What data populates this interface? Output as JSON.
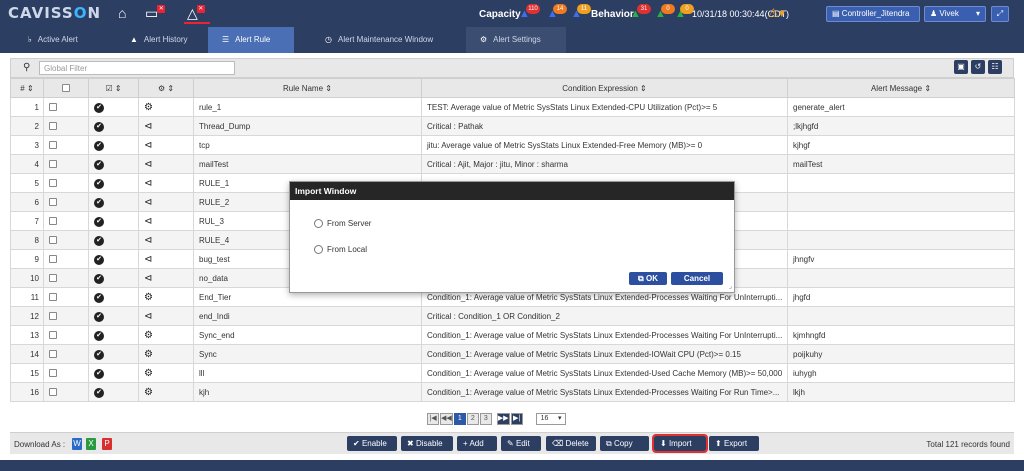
{
  "app": {
    "logo_left": "CAVISS",
    "logo_o": "O",
    "logo_right": "N"
  },
  "topbar": {
    "capacity_label": "Capacity",
    "capacity_badges": [
      "110",
      "14",
      "11"
    ],
    "behavior_label": "Behavior",
    "behavior_badges": [
      "31",
      "0",
      "0"
    ],
    "datetime": "10/31/18 00:30:44(CDT)",
    "controller_label": "Controller_Jitendra",
    "user_label": "Vivek"
  },
  "tabs": [
    {
      "label": "Active Alert"
    },
    {
      "label": "Alert History"
    },
    {
      "label": "Alert Rule"
    },
    {
      "label": "Alert Maintenance Window"
    },
    {
      "label": "Alert Settings"
    }
  ],
  "filter": {
    "placeholder": "Global Filter"
  },
  "table": {
    "headers": {
      "num": "#",
      "rule_name": "Rule Name",
      "condition": "Condition Expression",
      "message": "Alert Message"
    },
    "rows": [
      {
        "n": "1",
        "icon": "gear",
        "name": "rule_1",
        "cond": "TEST: Average value of Metric SysStats Linux Extended-CPU Utilization (Pct)>= 5",
        "msg": "generate_alert"
      },
      {
        "n": "2",
        "icon": "share",
        "name": "Thread_Dump",
        "cond": "Critical : Pathak",
        "msg": ";lkjhgfd"
      },
      {
        "n": "3",
        "icon": "share",
        "name": "tcp",
        "cond": "jitu: Average value of Metric SysStats Linux Extended-Free Memory (MB)>= 0",
        "msg": "kjhgf"
      },
      {
        "n": "4",
        "icon": "share",
        "name": "mailTest",
        "cond": "Critical : Ajit, Major : jitu, Minor : sharma",
        "msg": "mailTest"
      },
      {
        "n": "5",
        "icon": "share",
        "name": "RULE_1",
        "cond": "",
        "msg": ""
      },
      {
        "n": "6",
        "icon": "share",
        "name": "RULE_2",
        "cond": "",
        "msg": ""
      },
      {
        "n": "7",
        "icon": "share",
        "name": "RUL_3",
        "cond": "",
        "msg": ""
      },
      {
        "n": "8",
        "icon": "share",
        "name": "RULE_4",
        "cond": "",
        "msg": ""
      },
      {
        "n": "9",
        "icon": "share",
        "name": "bug_test",
        "cond": "",
        "msg": "jhngfv"
      },
      {
        "n": "10",
        "icon": "share",
        "name": "no_data",
        "cond": "",
        "msg": ""
      },
      {
        "n": "11",
        "icon": "gear",
        "name": "End_Tier",
        "cond": "Condition_1: Average value of Metric SysStats Linux Extended-Processes Waiting For UnInterrupti...",
        "msg": "jhgfd"
      },
      {
        "n": "12",
        "icon": "share",
        "name": "end_Indi",
        "cond": "Critical : Condition_1 OR Condition_2",
        "msg": ""
      },
      {
        "n": "13",
        "icon": "gear",
        "name": "Sync_end",
        "cond": "Condition_1: Average value of Metric SysStats Linux Extended-Processes Waiting For UnInterrupti...",
        "msg": "kjmhngfd"
      },
      {
        "n": "14",
        "icon": "gear",
        "name": "Sync",
        "cond": "Condition_1: Average value of Metric SysStats Linux Extended-IOWait CPU (Pct)>= 0.15",
        "msg": "poijkuhy"
      },
      {
        "n": "15",
        "icon": "gear",
        "name": "lll",
        "cond": "Condition_1: Average value of Metric SysStats Linux Extended-Used Cache Memory (MB)>= 50,000",
        "msg": "iuhygh"
      },
      {
        "n": "16",
        "icon": "gear",
        "name": "kjh",
        "cond": "Condition_1: Average value of Metric SysStats Linux Extended-Processes Waiting For Run Time>...",
        "msg": "lkjh"
      }
    ]
  },
  "pager": {
    "pages": [
      "1",
      "2",
      "3"
    ],
    "page_size": "16"
  },
  "footer": {
    "download_label": "Download As :",
    "actions": [
      {
        "label": "Enable"
      },
      {
        "label": "Disable"
      },
      {
        "label": "Add"
      },
      {
        "label": "Edit"
      },
      {
        "label": "Delete"
      },
      {
        "label": "Copy"
      },
      {
        "label": "Import"
      },
      {
        "label": "Export"
      }
    ],
    "total": "Total 121 records found"
  },
  "modal": {
    "title": "Import Window",
    "option_server": "From Server",
    "option_local": "From Local",
    "ok_label": "OK",
    "cancel_label": "Cancel"
  },
  "colors": {
    "header_bg": "#2d3e63",
    "active_tab": "#4a6fb5",
    "highlight": "#e03030"
  }
}
